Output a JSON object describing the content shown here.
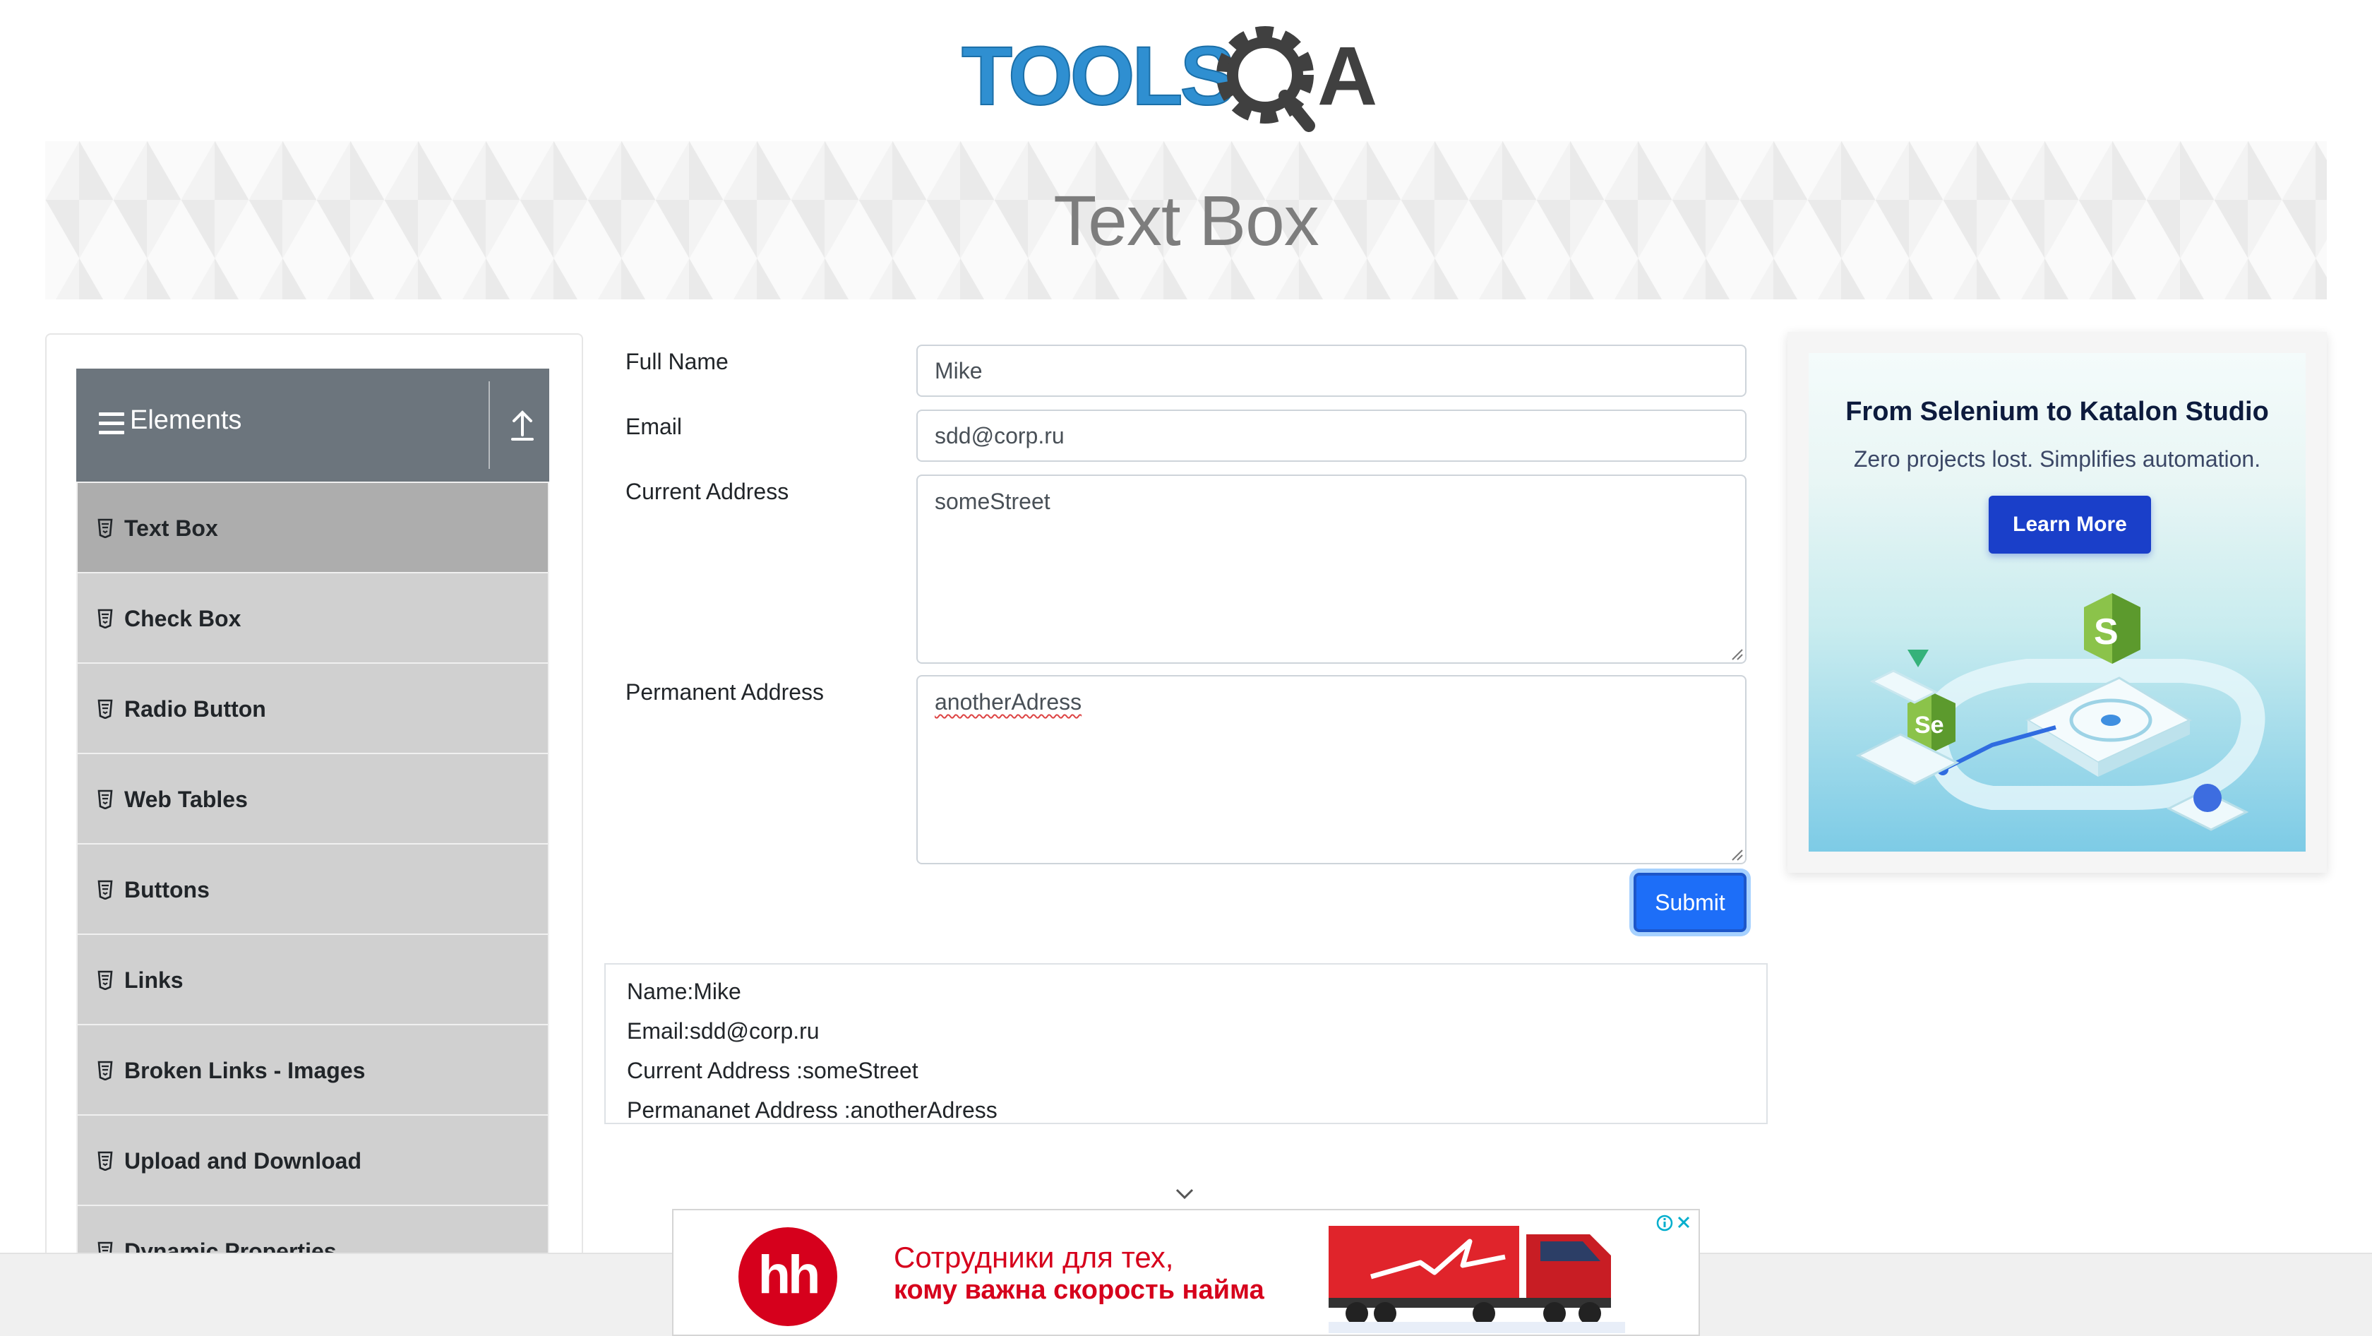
{
  "brand": {
    "logo_text_left": "TOOLS",
    "logo_text_right": "A"
  },
  "page": {
    "title": "Text Box"
  },
  "sidebar": {
    "group_title": "Elements",
    "items": [
      {
        "label": "Text Box"
      },
      {
        "label": "Check Box"
      },
      {
        "label": "Radio Button"
      },
      {
        "label": "Web Tables"
      },
      {
        "label": "Buttons"
      },
      {
        "label": "Links"
      },
      {
        "label": "Broken Links - Images"
      },
      {
        "label": "Upload and Download"
      },
      {
        "label": "Dynamic Properties"
      }
    ]
  },
  "form": {
    "full_name": {
      "label": "Full Name",
      "value": "Mike"
    },
    "email": {
      "label": "Email",
      "value": "sdd@corp.ru"
    },
    "current_address": {
      "label": "Current Address",
      "value": "someStreet"
    },
    "permanent_address": {
      "label": "Permanent Address",
      "value": "anotherAdress"
    },
    "submit_label": "Submit"
  },
  "output": {
    "name": "Name:Mike",
    "email": "Email:sdd@corp.ru",
    "current_address": "Current Address :someStreet",
    "permanent_address": "Permananet Address :anotherAdress"
  },
  "side_ad": {
    "title": "From Selenium to Katalon Studio",
    "subtitle": "Zero projects lost. Simplifies automation.",
    "button": "Learn More",
    "badge_s": "S",
    "badge_se": "Se"
  },
  "bottom_ad": {
    "logo": "hh",
    "line1": "Сотрудники для тех,",
    "line2": "кому важна скорость найма"
  },
  "colors": {
    "menu_header": "#6c757d",
    "menu_item": "#d0d0d0",
    "menu_item_active": "#adadad",
    "submit": "#1d6ef8",
    "logo_blue": "#2f8fd1",
    "logo_dark": "#404040",
    "ad_button": "#1a3fc9",
    "hh_red": "#d6001c"
  },
  "icons": [
    "gear-logo-icon",
    "hamburger-icon",
    "collapse-arrow-icon",
    "html5-icon",
    "resize-grip-icon",
    "chevron-down-icon",
    "adchoices-icon",
    "close-icon"
  ]
}
